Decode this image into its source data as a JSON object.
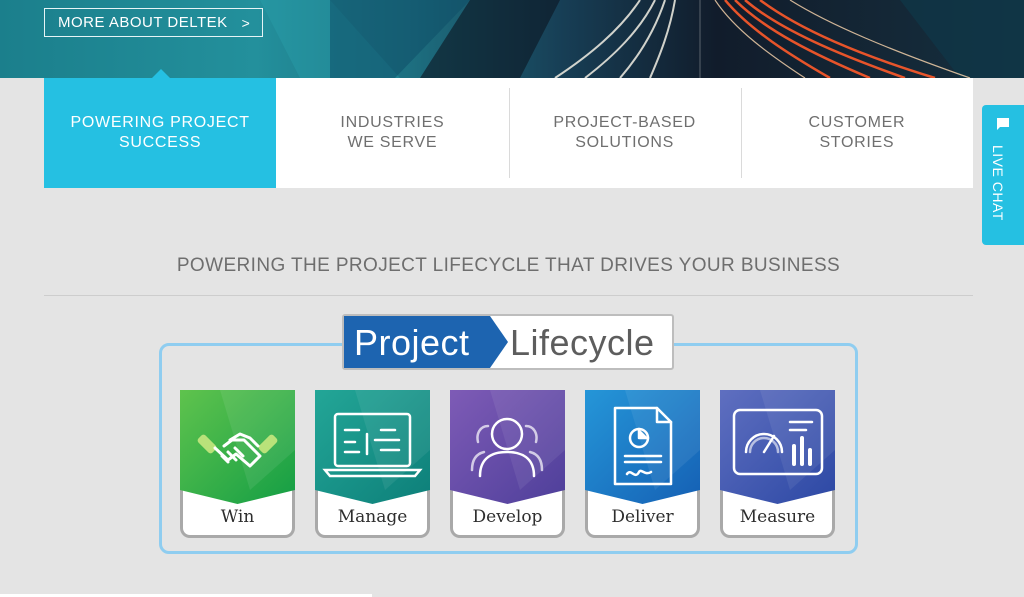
{
  "hero": {
    "more_button": "MORE ABOUT DELTEK",
    "more_chevron": ">"
  },
  "tabs": [
    {
      "label": "POWERING PROJECT\nSUCCESS",
      "active": true
    },
    {
      "label": "INDUSTRIES\nWE SERVE",
      "active": false
    },
    {
      "label": "PROJECT-BASED\nSOLUTIONS",
      "active": false
    },
    {
      "label": "CUSTOMER\nSTORIES",
      "active": false
    }
  ],
  "live_chat": {
    "label": "LIVE CHAT",
    "icon": "chat-bubble-icon"
  },
  "section": {
    "title": "POWERING THE PROJECT LIFECYCLE THAT DRIVES YOUR BUSINESS"
  },
  "lifecycle": {
    "title_left": "Project",
    "title_right": "Lifecycle",
    "stages": [
      {
        "label": "Win",
        "icon": "handshake-icon",
        "color": "#34b34a"
      },
      {
        "label": "Manage",
        "icon": "laptop-icon",
        "color": "#169487"
      },
      {
        "label": "Develop",
        "icon": "people-icon",
        "color": "#6a4fa6"
      },
      {
        "label": "Deliver",
        "icon": "document-icon",
        "color": "#1b77c9"
      },
      {
        "label": "Measure",
        "icon": "dashboard-icon",
        "color": "#3c56b0"
      }
    ]
  },
  "colors": {
    "accent": "#25c0e2",
    "frame": "#8fcdf0",
    "title_blue": "#1d64b0"
  }
}
